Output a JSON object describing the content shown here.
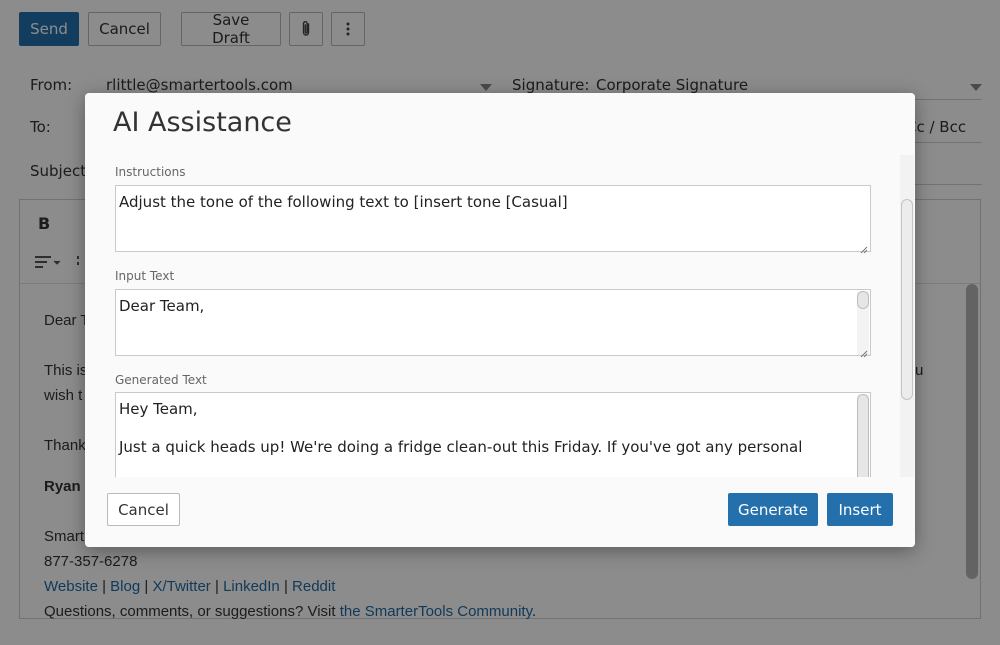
{
  "toolbar": {
    "send_label": "Send",
    "cancel_label": "Cancel",
    "save_draft_label": "Save Draft",
    "attach_icon": "paperclip-icon",
    "more_icon": "more-vertical-icon"
  },
  "compose": {
    "from_label": "From:",
    "from_value": "rlittle@smartertools.com",
    "signature_label": "Signature:",
    "signature_value": "Corporate Signature",
    "to_label": "To:",
    "cc_bcc_label": "Cc / Bcc",
    "subject_label": "Subject:"
  },
  "editor": {
    "bold_label": "B",
    "body": {
      "greeting": "Dear T",
      "para_1a": "This is",
      "para_1b": "wish t",
      "para_1_tail": "u",
      "thanks": "Thank",
      "name": "Ryan",
      "company": "Smart",
      "phone": "877-357-6278",
      "links": [
        "Website",
        "Blog",
        "X/Twitter",
        "LinkedIn",
        "Reddit"
      ],
      "link_separator": "|",
      "footer_text": "Questions, comments, or suggestions? Visit ",
      "footer_link": "the SmarterTools Community",
      "footer_end": "."
    }
  },
  "modal": {
    "title": "AI Assistance",
    "instructions_label": "Instructions",
    "instructions_value": "Adjust the tone of the following text to [insert tone [Casual]",
    "input_label": "Input Text",
    "input_value": "Dear Team,",
    "generated_label": "Generated Text",
    "generated_line_1": "Hey Team,",
    "generated_line_2": "Just a quick heads up! We're doing a fridge clean-out this Friday. If you've got any personal",
    "cancel_label": "Cancel",
    "generate_label": "Generate",
    "insert_label": "Insert"
  },
  "colors": {
    "primary": "#2470ad",
    "link": "#1f6aa5",
    "overlay": "rgba(0,0,0,0.45)"
  }
}
